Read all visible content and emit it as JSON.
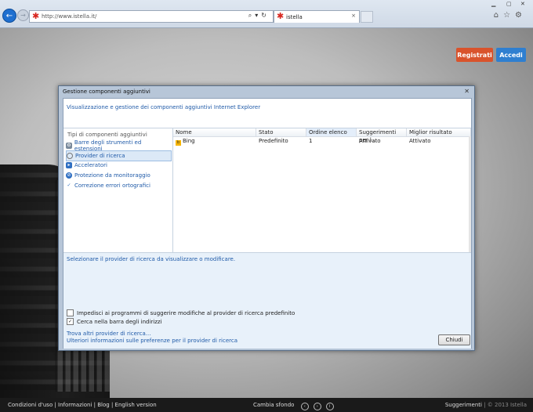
{
  "browser": {
    "url": "http://www.istella.it/",
    "tab_title": "istella",
    "tab_close": "×"
  },
  "page": {
    "register_label": "Registrati",
    "login_label": "Accedi"
  },
  "dialog": {
    "title": "Gestione componenti aggiuntivi",
    "close": "✕",
    "header_text": "Visualizzazione e gestione dei componenti aggiuntivi Internet Explorer",
    "types_heading": "Tipi di componenti aggiuntivi",
    "types": [
      {
        "label": "Barre degli strumenti ed estensioni",
        "icon": "gear-icon"
      },
      {
        "label": "Provider di ricerca",
        "icon": "search-icon"
      },
      {
        "label": "Acceleratori",
        "icon": "accelerator-icon"
      },
      {
        "label": "Protezione da monitoraggio",
        "icon": "block-icon"
      },
      {
        "label": "Correzione errori ortografici",
        "icon": "spellcheck-icon"
      }
    ],
    "columns": [
      "Nome",
      "Stato",
      "Ordine elenco",
      "Suggerimenti per l...",
      "Miglior risultato"
    ],
    "rows": [
      {
        "name": "Bing",
        "stato": "Predefinito",
        "ordine": "1",
        "suggerimenti": "Attivato",
        "miglior": "Attivato"
      }
    ],
    "select_text": "Selezionare il provider di ricerca da visualizzare o modificare.",
    "checkbox_1": "Impedisci ai programmi di suggerire modifiche al provider di ricerca predefinito",
    "checkbox_2": "Cerca nella barra degli indirizzi",
    "link_1": "Trova altri provider di ricerca...",
    "link_2": "Ulteriori informazioni sulle preferenze per il provider di ricerca",
    "close_button": "Chiudi"
  },
  "footer": {
    "links": "Condizioni d'uso  |  Informazioni  |  Blog  |  English version",
    "change_bg": "Cambia sfondo",
    "suggestions": "Suggerimenti",
    "copyright": "|  © 2013 Istella"
  }
}
